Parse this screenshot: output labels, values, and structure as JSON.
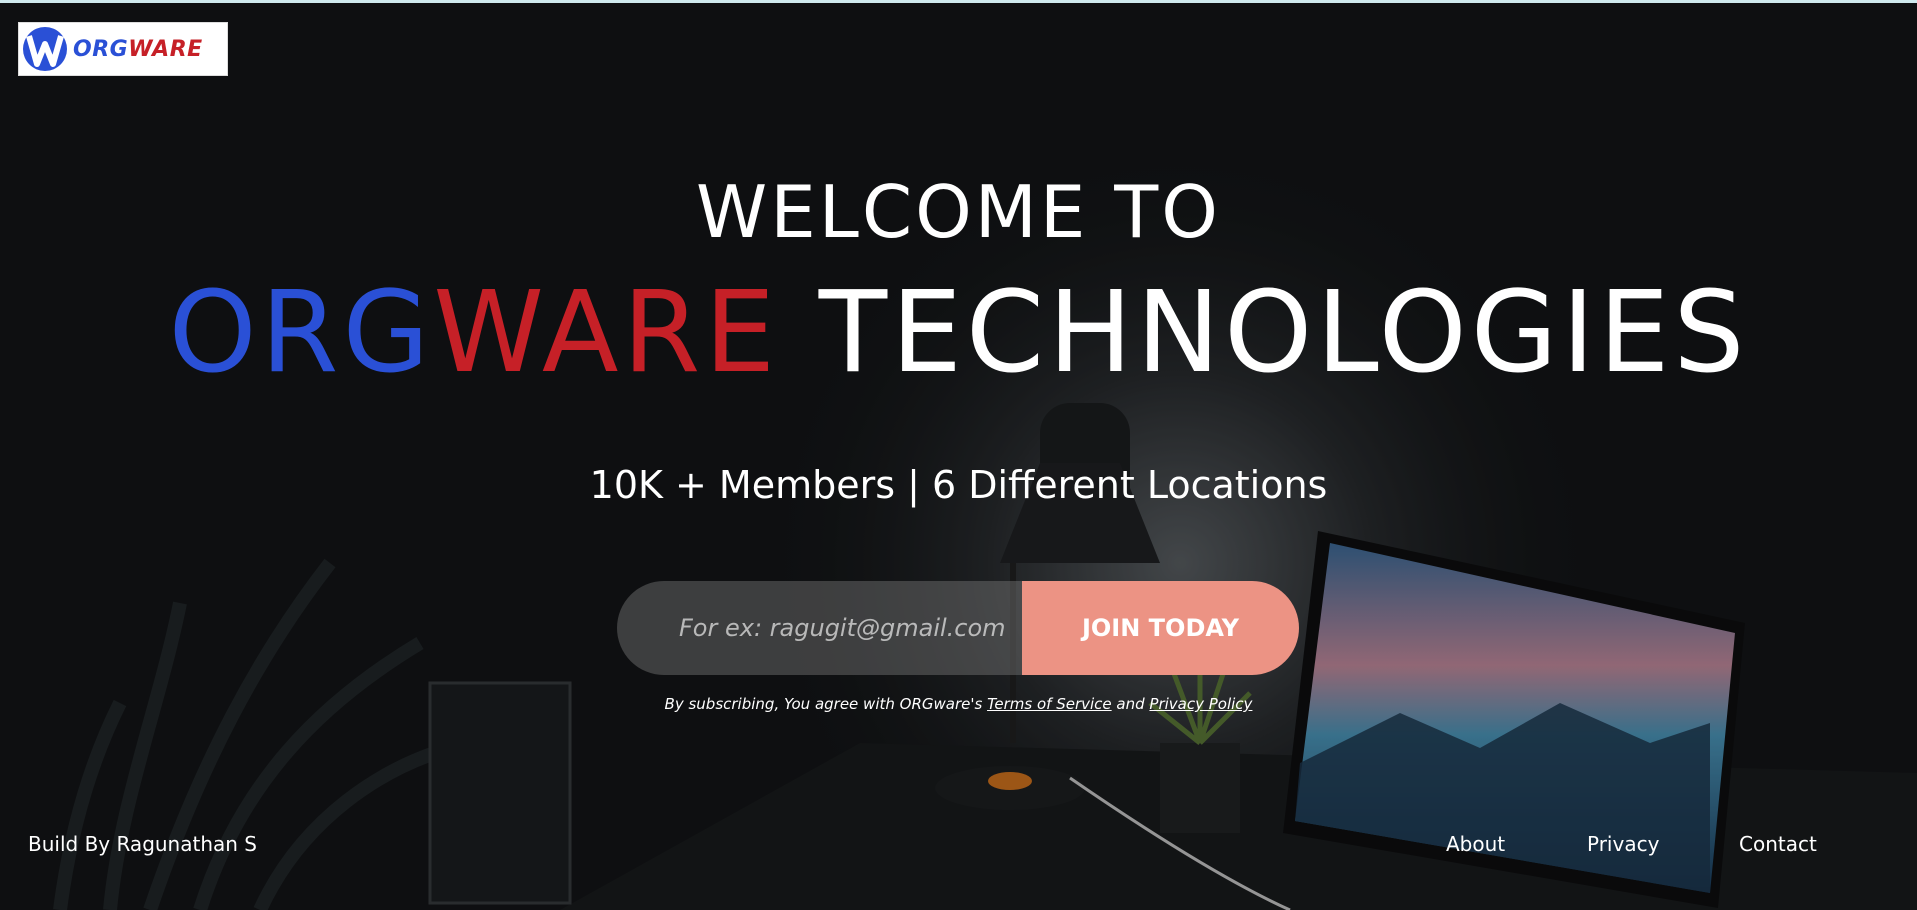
{
  "brand": {
    "logo_text_part1": "ORG",
    "logo_text_part2": "WARE",
    "colors": {
      "blue": "#2a50d6",
      "red": "#c62027",
      "accent": "#ec9384"
    }
  },
  "hero": {
    "welcome": "WELCOME TO",
    "title_part1": "ORG",
    "title_part2": "WARE",
    "title_part3": " TECHNOLOGIES",
    "stats": "10K + Members | 6 Different Locations"
  },
  "signup": {
    "email_placeholder": "For ex: ragugit@gmail.com",
    "join_label": "JOIN TODAY",
    "disclaimer_prefix": "By subscribing, You agree with ORGware's ",
    "terms_label": "Terms of Service",
    "and_text": " and ",
    "privacy_label": "Privacy Policy"
  },
  "footer": {
    "credit": "Build By Ragunathan S",
    "links": [
      "About",
      "Privacy",
      "Contact"
    ]
  },
  "icons": {
    "logo_mark": "orgware-w-logo-icon"
  }
}
